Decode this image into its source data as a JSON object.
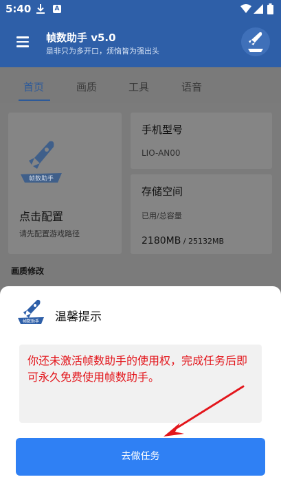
{
  "status_bar": {
    "time": "5:40",
    "notif_letter": "A"
  },
  "app_bar": {
    "title": "帧数助手 v5.0",
    "subtitle": "是非只为多开口，烦恼皆为强出头",
    "logo_caption": "帧数助手"
  },
  "tabs": [
    {
      "label": "首页",
      "active": true
    },
    {
      "label": "画质",
      "active": false
    },
    {
      "label": "工具",
      "active": false
    },
    {
      "label": "语音",
      "active": false
    }
  ],
  "home": {
    "config_title": "点击配置",
    "config_subtitle": "请先配置游戏路径",
    "logo_caption": "帧数助手",
    "phone_model_title": "手机型号",
    "phone_model_value": "LIO-AN00",
    "storage_title": "存储空间",
    "storage_label": "已用/总容量",
    "storage_used": "2180MB",
    "storage_total": " / 25132MB",
    "section_label": "画质修改"
  },
  "dialog": {
    "title": "温馨提示",
    "logo_caption": "帧数助手",
    "message": "你还未激活帧数助手的使用权，完成任务后即可永久免费使用帧数助手。",
    "button": "去做任务"
  },
  "colors": {
    "primary": "#2e5fa8",
    "button": "#2f80f4",
    "message_text": "#e3161c",
    "arrow": "#e3161c"
  }
}
